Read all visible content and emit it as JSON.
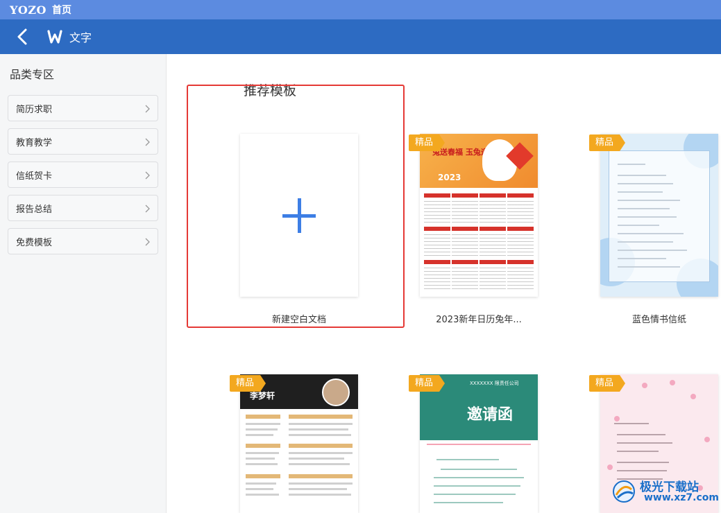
{
  "topbar": {
    "brand": "YOZO",
    "home_label": "首页"
  },
  "navbar": {
    "title": "文字",
    "back_icon": "back-arrow-icon",
    "logo_icon": "w-logo-icon"
  },
  "sidebar": {
    "title": "品类专区",
    "items": [
      {
        "label": "简历求职"
      },
      {
        "label": "教育教学"
      },
      {
        "label": "信纸贺卡"
      },
      {
        "label": "报告总结"
      },
      {
        "label": "免费模板"
      }
    ]
  },
  "main": {
    "section_title": "推荐模板",
    "badge_label": "精品",
    "templates": [
      {
        "label": "新建空白文档"
      },
      {
        "label": "2023新年日历兔年..."
      },
      {
        "label": "蓝色情书信纸"
      },
      {
        "label": ""
      },
      {
        "label": ""
      },
      {
        "label": ""
      }
    ],
    "preview_texts": {
      "calendar_year": "2023",
      "calendar_slogan": "兔送春福 玉兔迎春到",
      "resume_name": "李梦轩",
      "invite_title": "邀请函",
      "invite_company": "XXXXXXX 限责任公司"
    }
  },
  "watermark": {
    "name": "极光下载站",
    "url": "www.xz7.com"
  },
  "colors": {
    "accent": "#2d6bc2",
    "topbar": "#5c8be0",
    "badge": "#f3a81f",
    "highlight": "#e53935",
    "plus": "#3d7ee5"
  }
}
